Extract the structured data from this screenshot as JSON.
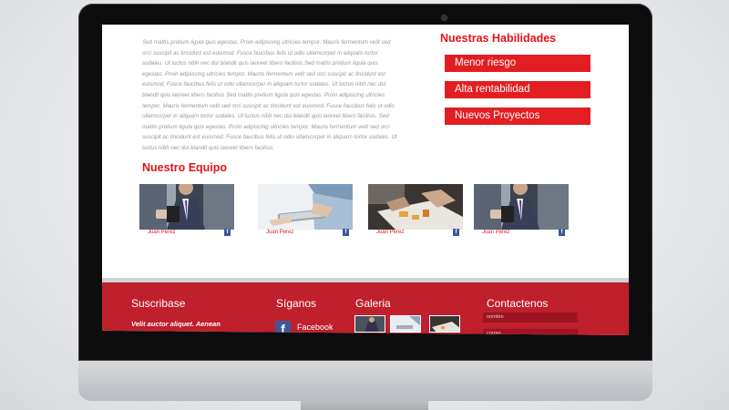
{
  "lorem": "Sed mattis pretium ligula quis egestas. Proin adipiscing ultricies tempor. Mauris fermentum velit sed orci suscipit ac tincidunt est euismod. Fusce faucibus felis ut odio ullamcorper in aliquam tortor sodales. Ut luctus nibh nec dui blandit quis laoreet libero facilisis.Sed mattis pretium ligula quis egestas. Proin adipiscing ultricies tempor. Mauris fermentum velit sed orci suscipit ac tincidunt est euismod. Fusce faucibus felis ut odio ullamcorper in aliquam tortor sodales. Ut luctus nibh nec dui blandit quis laoreet libero facilisis Sed mattis pretium ligula quis egestas. Proin adipiscing ultricies tempor. Mauris fermentum velit sed orci suscipit ac tincidunt est euismod. Fusce faucibus felis ut odio ullamcorper in aliquam tortor sodales. Ut luctus nibh nec dui blandit quis laoreet libero facilisis. Sed mattis pretium ligula quis egestas. Proin adipiscing ultricies tempor. Mauris fermentum velit sed orci suscipit ac tincidunt est euismod. Fusce faucibus felis ut odio ullamcorper in aliquam tortor sodales. Ut luctus nibh nec dui blandit quis laoreet libero facilisis.",
  "skills": {
    "title": "Nuestras Habilidades",
    "items": [
      "Menor riesgo",
      "Alta rentabilidad",
      "Nuevos Proyectos"
    ]
  },
  "team": {
    "title": "Nuestro Equipo",
    "members": [
      {
        "name": "Juan Perez"
      },
      {
        "name": "Juan Perez"
      },
      {
        "name": "Juan Perez"
      },
      {
        "name": "Juan Perez"
      }
    ]
  },
  "footer": {
    "subscribe": {
      "title": "Suscribase",
      "text": "Velit auctor aliquet. Aenean sollicitudin, lorem quis bibendum auctor."
    },
    "follow": {
      "title": "Síganos",
      "facebook_label": "Facebook",
      "facebook_icon": "facebook-icon"
    },
    "gallery": {
      "title": "Galeria"
    },
    "contact": {
      "title": "Contactenos",
      "name_placeholder": "nombre",
      "email_placeholder": "correo"
    }
  },
  "colors": {
    "accent": "#e31e23",
    "footer": "#c01f2c",
    "facebook": "#3b5998"
  }
}
